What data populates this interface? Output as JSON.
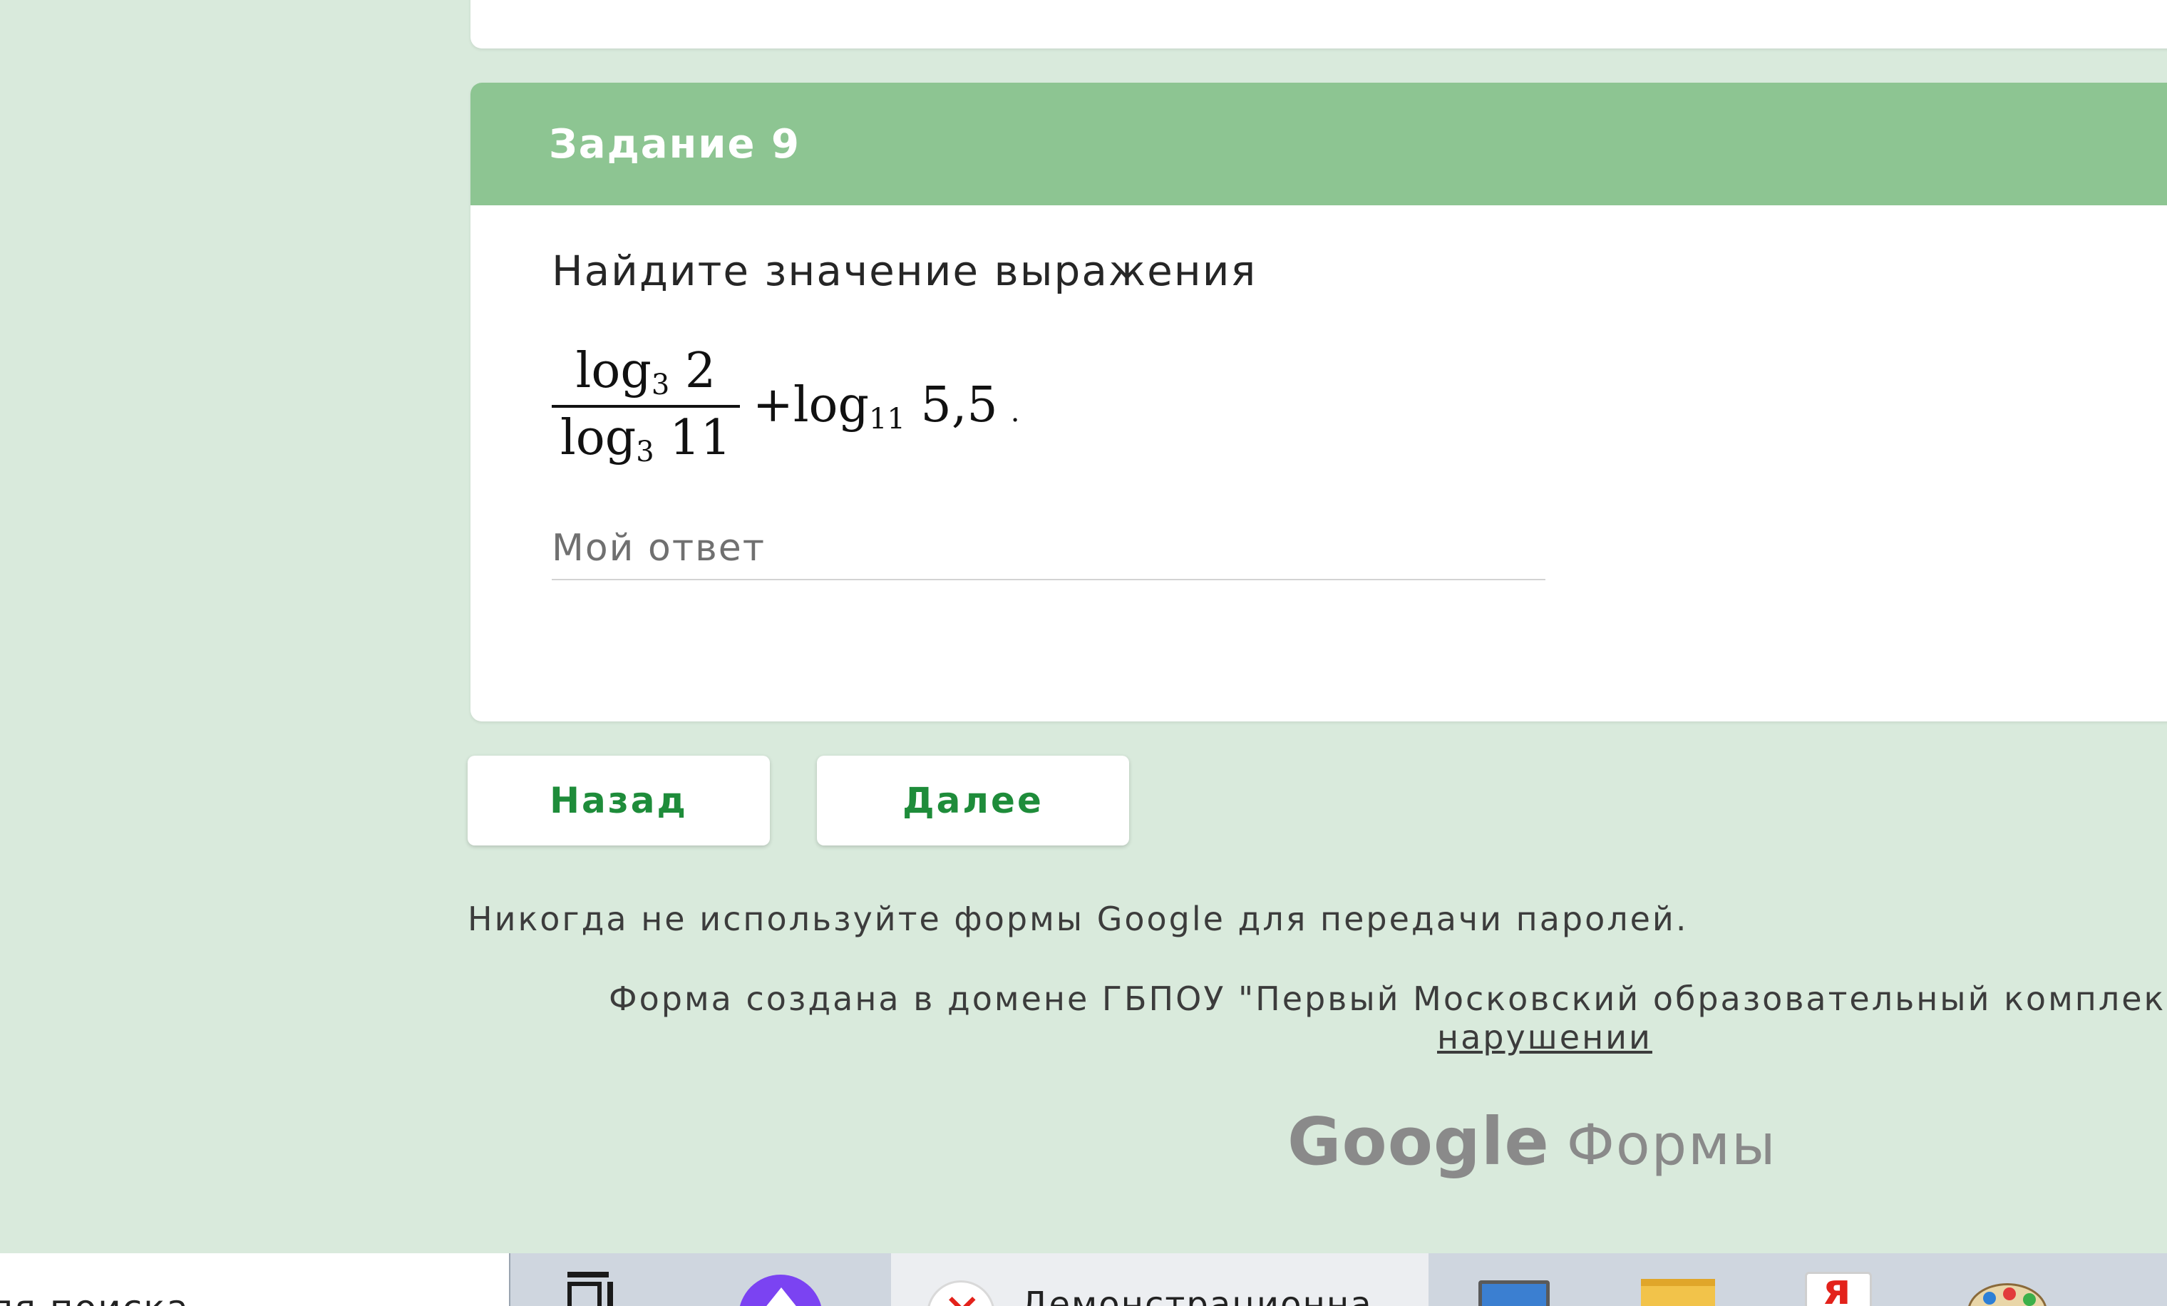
{
  "question": {
    "header_title": "Задание 9",
    "prompt": "Найдите значение выражения",
    "formula": {
      "numerator_base": "log",
      "numerator_sub": "3",
      "numerator_arg": " 2",
      "denominator_base": "log",
      "denominator_sub": "3",
      "denominator_arg": " 11",
      "plus": "+",
      "term_base": "log",
      "term_sub": "11",
      "term_arg": " 5,5",
      "end_dot": "."
    },
    "answer_placeholder": "Мой ответ"
  },
  "navigation": {
    "back_label": "Назад",
    "next_label": "Далее"
  },
  "footer": {
    "password_warning": "Никогда не используйте формы Google для передачи паролей.",
    "domain_note": "Форма создана в домене ГБПОУ \"Первый Московский образовательный комплек",
    "report_link": "нарушении",
    "logo_google": "Google",
    "logo_forms": "Формы"
  },
  "taskbar": {
    "search_text": "ля поиска",
    "browser_window_label": "Демонстрационна"
  },
  "colors": {
    "page_background": "#d9eadc",
    "header_green": "#8dc592",
    "button_text_green": "#1e8c3a"
  },
  "icons": {
    "task_view": "task-view-icon",
    "alice": "alice-assistant-icon",
    "yandex_browser": "yandex-browser-icon",
    "control_panel": "control-panel-icon",
    "file_explorer": "folder-icon",
    "yandex": "yandex-icon",
    "paint": "paint-palette-icon"
  }
}
